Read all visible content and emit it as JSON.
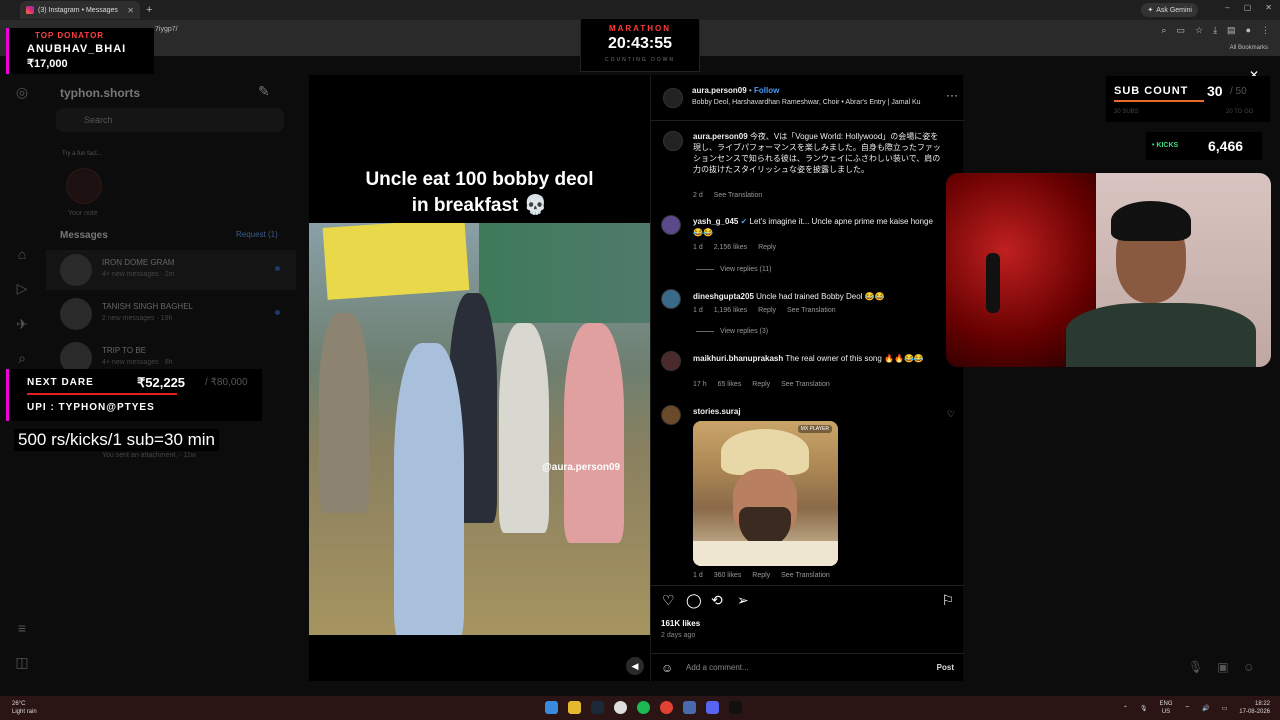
{
  "browser": {
    "tab_title": "(3) Instagram • Messages",
    "url": "7iygp7/",
    "ask_gemini": "Ask Gemini",
    "all_bookmarks": "All Bookmarks"
  },
  "dm": {
    "username": "typhon.shorts",
    "search_placeholder": "Search",
    "note_text": "Try a fun fact...",
    "your_note": "Your note",
    "messages_heading": "Messages",
    "requests_label": "Request (1)",
    "conversations": [
      {
        "name": "IRON DOME GRAM",
        "sub": "4+ new messages · 2m"
      },
      {
        "name": "TANISH SINGH BAGHEL",
        "sub": "2 new messages · 19h"
      },
      {
        "name": "TRIP TO BE",
        "sub": "4+ new messages · 8h"
      }
    ],
    "sent_attachment": "You sent an attachment. · 11w"
  },
  "overlays": {
    "top_donator_label": "TOP DONATOR",
    "top_donator_name": "ANUBHAV_BHAI",
    "top_donator_amount": "₹17,000",
    "marathon_label": "MARATHON",
    "marathon_time": "20:43:55",
    "marathon_sub": "COUNTING DOWN",
    "sub_count_label": "SUB COUNT",
    "sub_count_value": "30",
    "sub_count_goal": "/ 50",
    "sub_count_foot_left": "30 SUBS",
    "sub_count_foot_right": "20 TO GO",
    "kicks_label": "• KICKS",
    "kicks_value": "6,466",
    "next_dare_label": "NEXT DARE",
    "next_dare_amount": "₹52,225",
    "next_dare_goal": "/ ₹80,000",
    "next_dare_progress": 0.65,
    "upi_label": "UPI : TYPHON@PTYES",
    "rate_text": "500 rs/kicks/1 sub=30 min"
  },
  "post": {
    "video_caption_line1": "Uncle eat 100 bobby deol",
    "video_caption_line2": "in breakfast 💀",
    "watermark": "@aura.person09",
    "author": "aura.person09",
    "follow_label": "Follow",
    "audio_line": "Bobby Deol, Harshavardhan Rameshwar, Choir • Abrar's Entry | Jamal Ku",
    "description_user": "aura.person09",
    "description_text": "今夜、Vは「Vogue World: Hollywood」の会場に姿を現し、ライブパフォーマンスを楽しみました。自身も際立ったファッションセンスで知られる彼は、ランウェイにふさわしい装いで、肩の力の抜けたスタイリッシュな姿を披露しました。",
    "description_meta_time": "2 d",
    "see_translation": "See Translation",
    "comments": [
      {
        "user": "yash_g_045",
        "text": "Let's imagine it... Uncle apne prime me kaise honge 😂😂",
        "time": "1 d",
        "likes": "2,156 likes",
        "reply": "Reply",
        "view_replies": "View replies (11)"
      },
      {
        "user": "dineshgupta205",
        "text": "Uncle had trained Bobby Deol 😂😂",
        "time": "1 d",
        "likes": "1,196 likes",
        "reply": "Reply",
        "translation": "See Translation",
        "view_replies": "View replies (3)"
      },
      {
        "user": "maikhuri.bhanuprakash",
        "text": "The real owner of this song 🔥🔥😂😂",
        "time": "17 h",
        "likes": "65 likes",
        "reply": "Reply",
        "translation": "See Translation"
      },
      {
        "user": "stories.suraj",
        "time": "1 d",
        "likes": "360 likes",
        "reply": "Reply",
        "translation": "See Translation",
        "image_tag": "MX PLAYER"
      }
    ],
    "like_count": "161K likes",
    "posted_ago": "2 days ago",
    "add_comment_placeholder": "Add a comment...",
    "post_button": "Post"
  },
  "taskbar": {
    "weather_temp": "26°C",
    "weather_desc": "Light rain",
    "lang": "ENG",
    "region": "US",
    "time": "18:22",
    "date": "17-08-2026"
  }
}
